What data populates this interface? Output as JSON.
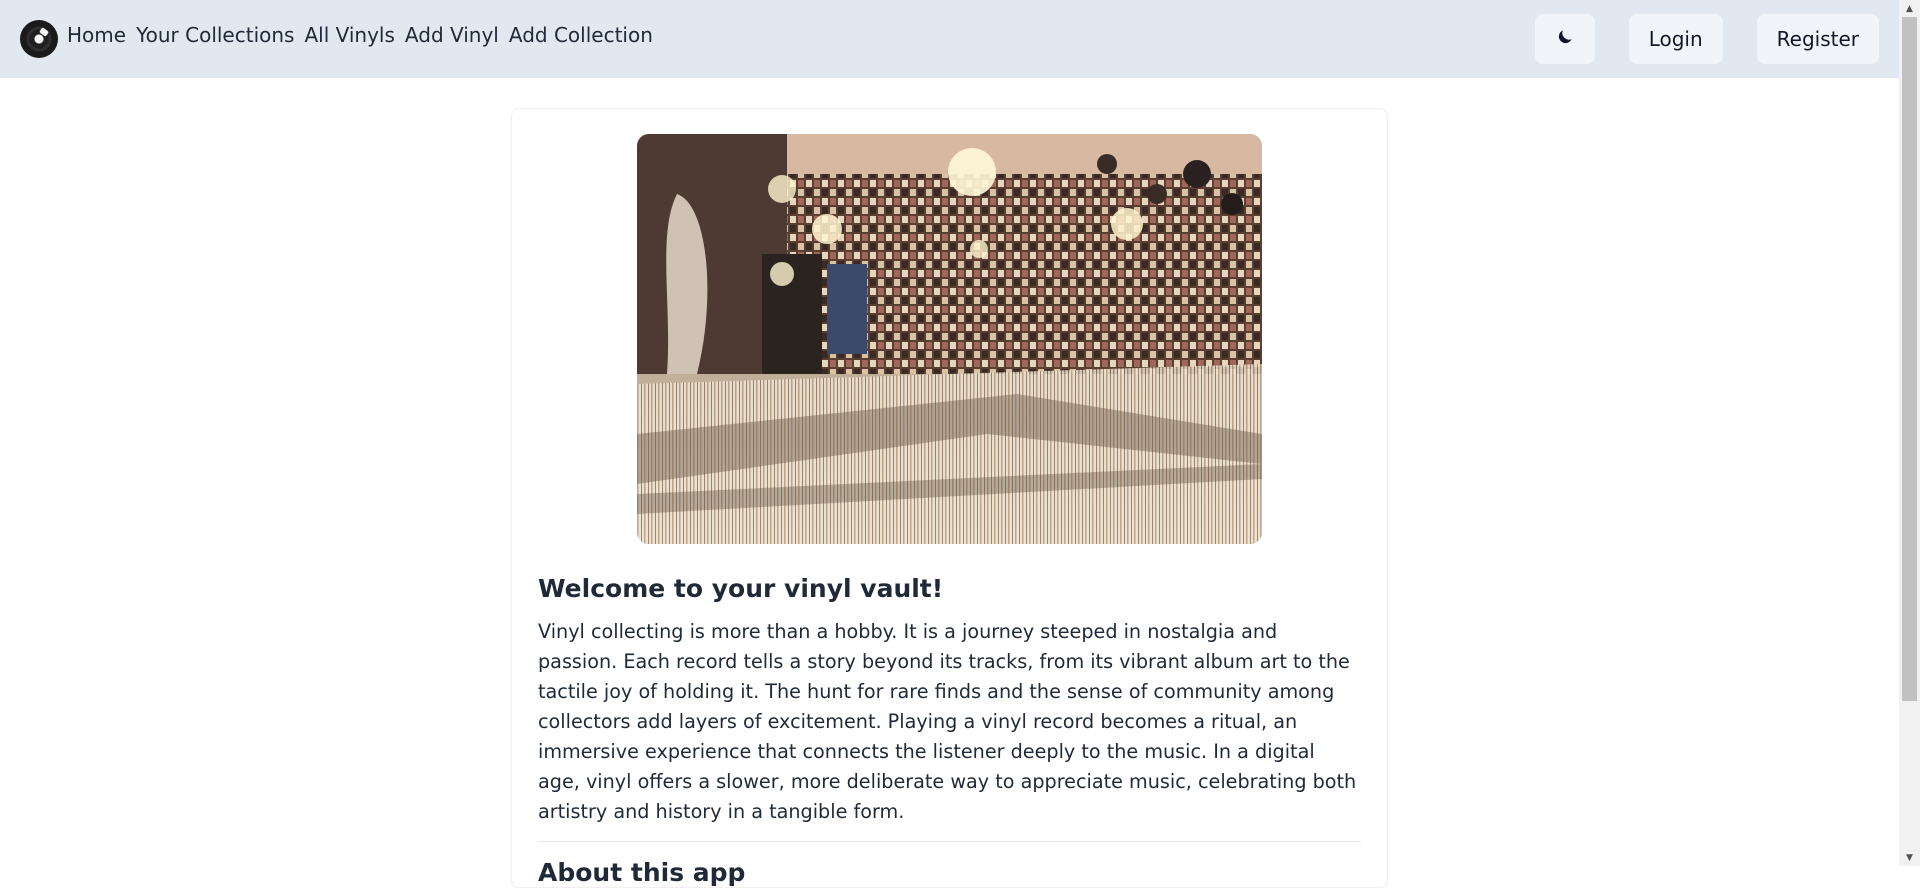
{
  "nav": {
    "links": [
      "Home",
      "Your Collections",
      "All Vinyls",
      "Add Vinyl",
      "Add Collection"
    ],
    "theme_icon": "moon-icon",
    "login_label": "Login",
    "register_label": "Register",
    "logo_icon": "vinyl-record-icon"
  },
  "main": {
    "hero_image_subject": "record-store-interior",
    "welcome_title": "Welcome to your vinyl vault!",
    "welcome_text": "Vinyl collecting is more than a hobby. It is a journey steeped in nostalgia and passion. Each record tells a story beyond its tracks, from its vibrant album art to the tactile joy of holding it. The hunt for rare finds and the sense of community among collectors add layers of excitement. Playing a vinyl record becomes a ritual, an immersive experience that connects the listener deeply to the music. In a digital age, vinyl offers a slower, more deliberate way to appreciate music, celebrating both artistry and history in a tangible form.",
    "about_title": "About this app"
  },
  "colors": {
    "navbar_bg": "#e2e8f0",
    "button_bg": "#f1f5f9",
    "text": "#1f2937"
  }
}
